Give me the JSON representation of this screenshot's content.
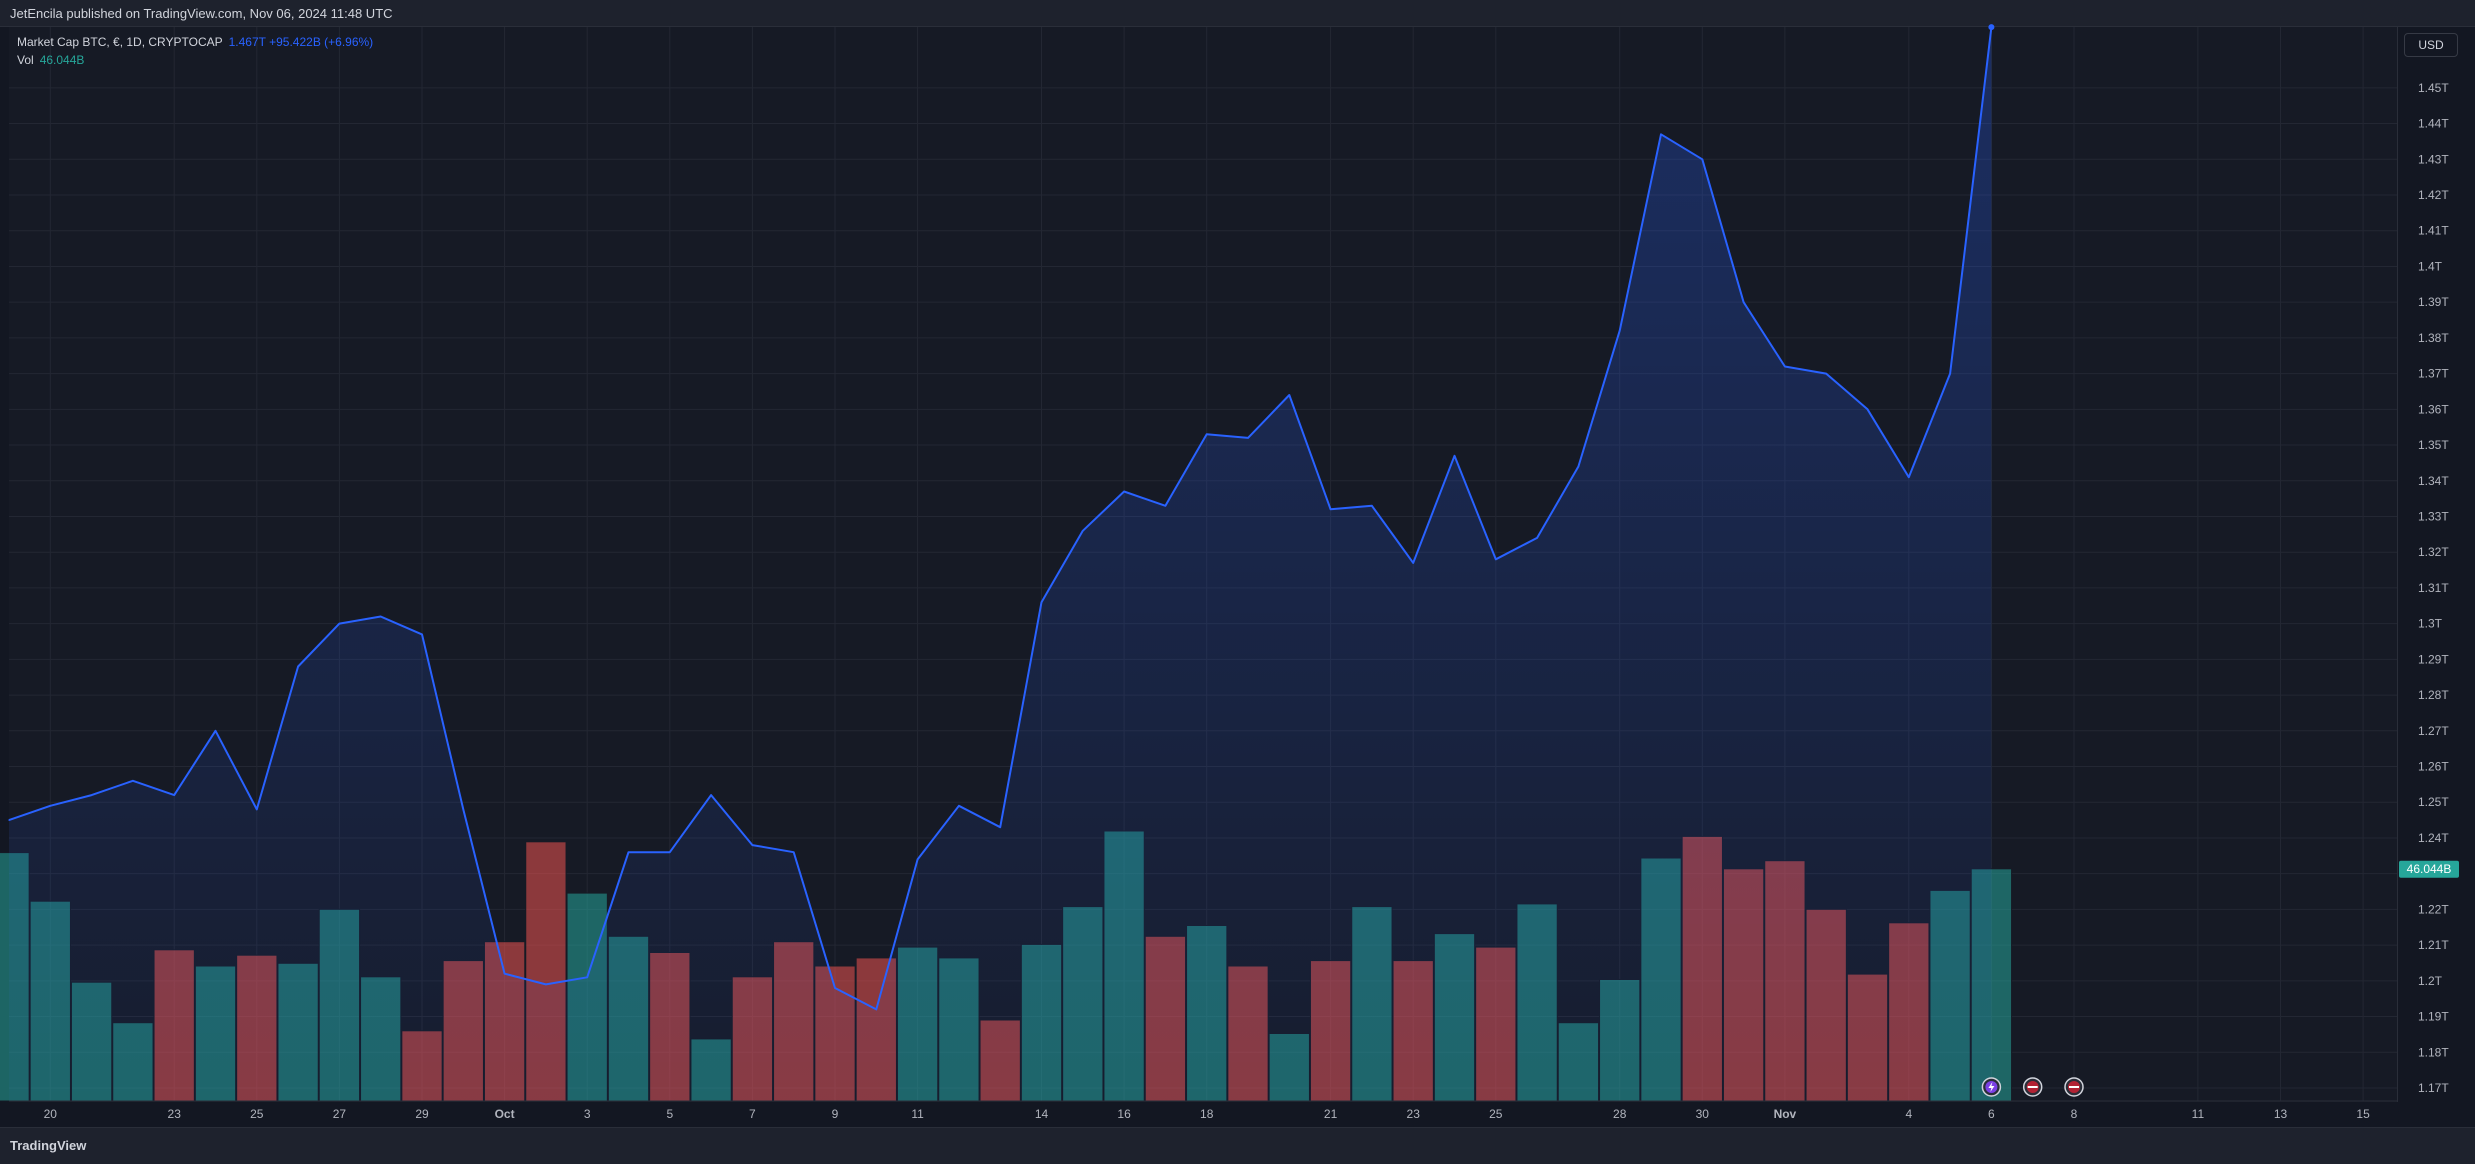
{
  "header": {
    "publish_line": "JetEncila published on TradingView.com, Nov 06, 2024 11:48 UTC"
  },
  "legend": {
    "symbol": "Market Cap BTC, €, 1D, CRYPTOCAP",
    "values": "1.467T  +95.422B (+6.96%)",
    "vol_label": "Vol",
    "vol_value": "46.044B"
  },
  "currency_button": "USD",
  "footer": {
    "brand": "TradingView"
  },
  "colors": {
    "line": "#2962ff",
    "up": "#26a69a",
    "down": "#ef5350",
    "background": "#161a25"
  },
  "chart_data": {
    "type": "area",
    "y_axis_unit": "T",
    "ylim": [
      1.165,
      1.465
    ],
    "y_ticks": [
      "1.17T",
      "1.18T",
      "1.19T",
      "1.2T",
      "1.21T",
      "1.22T",
      "1.23T",
      "1.24T",
      "1.25T",
      "1.26T",
      "1.27T",
      "1.28T",
      "1.29T",
      "1.3T",
      "1.31T",
      "1.32T",
      "1.33T",
      "1.34T",
      "1.35T",
      "1.36T",
      "1.37T",
      "1.38T",
      "1.39T",
      "1.4T",
      "1.41T",
      "1.42T",
      "1.43T",
      "1.44T",
      "1.45T"
    ],
    "y_tick_values": [
      1.17,
      1.18,
      1.19,
      1.2,
      1.21,
      1.22,
      1.23,
      1.24,
      1.25,
      1.26,
      1.27,
      1.28,
      1.29,
      1.3,
      1.31,
      1.32,
      1.33,
      1.34,
      1.35,
      1.36,
      1.37,
      1.38,
      1.39,
      1.4,
      1.41,
      1.42,
      1.43,
      1.44,
      1.45
    ],
    "x_ticks": [
      {
        "label": "20",
        "day": 1
      },
      {
        "label": "23",
        "day": 4
      },
      {
        "label": "25",
        "day": 6
      },
      {
        "label": "27",
        "day": 8
      },
      {
        "label": "29",
        "day": 10
      },
      {
        "label": "Oct",
        "day": 12
      },
      {
        "label": "3",
        "day": 14
      },
      {
        "label": "5",
        "day": 16
      },
      {
        "label": "7",
        "day": 18
      },
      {
        "label": "9",
        "day": 20
      },
      {
        "label": "11",
        "day": 22
      },
      {
        "label": "14",
        "day": 25
      },
      {
        "label": "16",
        "day": 27
      },
      {
        "label": "18",
        "day": 29
      },
      {
        "label": "21",
        "day": 32
      },
      {
        "label": "23",
        "day": 34
      },
      {
        "label": "25",
        "day": 36
      },
      {
        "label": "28",
        "day": 39
      },
      {
        "label": "30",
        "day": 41
      },
      {
        "label": "Nov",
        "day": 43
      },
      {
        "label": "4",
        "day": 46
      },
      {
        "label": "6",
        "day": 48
      },
      {
        "label": "8",
        "day": 50
      },
      {
        "label": "11",
        "day": 53
      },
      {
        "label": "13",
        "day": 55
      },
      {
        "label": "15",
        "day": 57
      }
    ],
    "series": [
      {
        "values": [
          1.245,
          1.249,
          1.252,
          1.256,
          1.252,
          1.27,
          1.248,
          1.288,
          1.3,
          1.302,
          1.297,
          1.248,
          1.202,
          1.199,
          1.201,
          1.236,
          1.236,
          1.252,
          1.238,
          1.236,
          1.198,
          1.192,
          1.234,
          1.249,
          1.243,
          1.306,
          1.326,
          1.337,
          1.333,
          1.353,
          1.352,
          1.364,
          1.332,
          1.333,
          1.317,
          1.347,
          1.318,
          1.324,
          1.344,
          1.382,
          1.437,
          1.43,
          1.39,
          1.372,
          1.37,
          1.36,
          1.341,
          1.37,
          1.467
        ]
      }
    ],
    "volume": {
      "last_value_label": "46.044B",
      "relative_heights": [
        0.92,
        0.74,
        0.44,
        0.29,
        0.56,
        0.5,
        0.54,
        0.51,
        0.71,
        0.46,
        0.26,
        0.52,
        0.59,
        0.96,
        0.77,
        0.61,
        0.55,
        0.23,
        0.46,
        0.59,
        0.5,
        0.53,
        0.57,
        0.53,
        0.3,
        0.58,
        0.72,
        1.0,
        0.61,
        0.65,
        0.5,
        0.25,
        0.52,
        0.72,
        0.52,
        0.62,
        0.57,
        0.73,
        0.29,
        0.45,
        0.9,
        0.98,
        0.86,
        0.89,
        0.71,
        0.47,
        0.66,
        0.78,
        0.86
      ],
      "directions": [
        "up",
        "up",
        "up",
        "up",
        "down",
        "up",
        "down",
        "up",
        "up",
        "up",
        "down",
        "down",
        "down",
        "down",
        "up",
        "up",
        "down",
        "up",
        "down",
        "down",
        "down",
        "down",
        "up",
        "up",
        "down",
        "up",
        "up",
        "up",
        "down",
        "up",
        "down",
        "up",
        "down",
        "up",
        "down",
        "up",
        "down",
        "up",
        "up",
        "up",
        "up",
        "down",
        "down",
        "down",
        "down",
        "down",
        "down",
        "up",
        "up"
      ]
    }
  }
}
